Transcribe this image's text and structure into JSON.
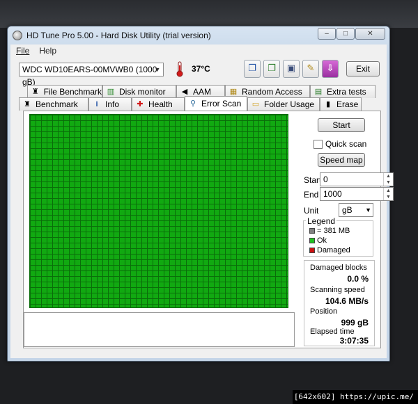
{
  "window": {
    "title": "HD Tune Pro 5.00 - Hard Disk Utility (trial version)",
    "controls": [
      "–",
      "□",
      "✕"
    ]
  },
  "menu": {
    "file": "File",
    "help": "Help"
  },
  "toolbar": {
    "drive": "WDC WD10EARS-00MVWB0 (1000 gB)",
    "temperature": "37°C",
    "exit_label": "Exit",
    "icons": [
      "copy-icon",
      "copy-all-icon",
      "save-icon",
      "options-icon",
      "download-icon"
    ]
  },
  "tabs_row1": [
    {
      "label": "File Benchmark",
      "icon": "file-benchmark-icon"
    },
    {
      "label": "Disk monitor",
      "icon": "disk-monitor-icon"
    },
    {
      "label": "AAM",
      "icon": "speaker-icon"
    },
    {
      "label": "Random Access",
      "icon": "random-access-icon"
    },
    {
      "label": "Extra tests",
      "icon": "extra-tests-icon"
    }
  ],
  "tabs_row2": [
    {
      "label": "Benchmark",
      "icon": "benchmark-icon"
    },
    {
      "label": "Info",
      "icon": "info-icon"
    },
    {
      "label": "Health",
      "icon": "health-icon"
    },
    {
      "label": "Error Scan",
      "icon": "magnifier-icon",
      "active": true
    },
    {
      "label": "Folder Usage",
      "icon": "folder-icon"
    },
    {
      "label": "Erase",
      "icon": "trash-icon"
    }
  ],
  "scan": {
    "start_button": "Start",
    "quick_scan_label": "Quick scan",
    "quick_scan_checked": false,
    "speed_map_button": "Speed map",
    "start_label": "Start",
    "start_value": "0",
    "end_label": "End",
    "end_value": "1000",
    "unit_label": "Unit",
    "unit_value": "gB"
  },
  "legend": {
    "title": "Legend",
    "items": [
      {
        "label": "= 381 MB",
        "color": "#808080"
      },
      {
        "label": "Ok",
        "color": "#22c022"
      },
      {
        "label": "Damaged",
        "color": "#cc1111"
      }
    ]
  },
  "stats": {
    "damaged_label": "Damaged blocks",
    "damaged_value": "0.0 %",
    "speed_label": "Scanning speed",
    "speed_value": "104.6 MB/s",
    "position_label": "Position",
    "position_value": "999 gB",
    "elapsed_label": "Elapsed time",
    "elapsed_value": "3:07:35"
  },
  "colors": {
    "map_ok": "#11a911",
    "map_grid": "#0a6d0a"
  },
  "watermark": "[642x602] https://upic.me/"
}
